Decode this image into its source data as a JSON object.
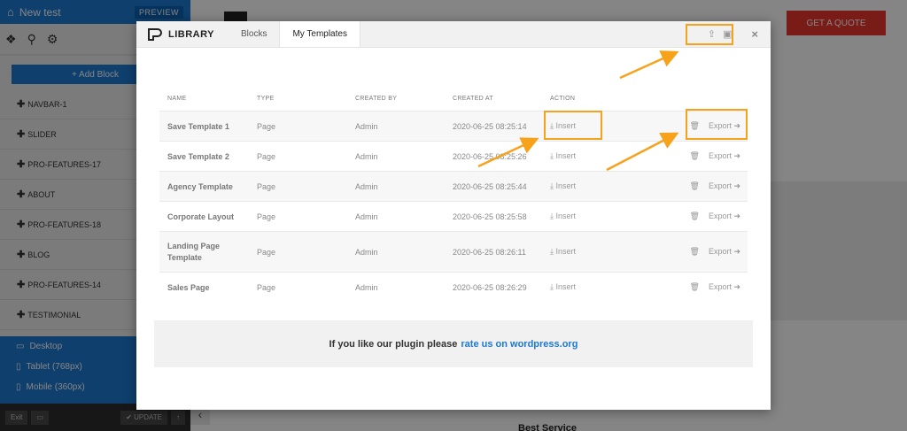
{
  "sidebar": {
    "title": "New test",
    "preview": "PREVIEW",
    "add_block": "+ Add Block",
    "items": [
      "NAVBAR-1",
      "SLIDER",
      "PRO-FEATURES-17",
      "ABOUT",
      "PRO-FEATURES-18",
      "BLOG",
      "PRO-FEATURES-14",
      "TESTIMONIAL"
    ],
    "devices": [
      "Desktop",
      "Tablet (768px)",
      "Mobile (360px)"
    ],
    "exit": "Exit",
    "update": "✔ UPDATE"
  },
  "site": {
    "quote_button": "GET A QUOTE",
    "best_service": "Best Service"
  },
  "modal": {
    "title": "LIBRARY",
    "tabs": [
      "Blocks",
      "My Templates"
    ],
    "active_tab": "My Templates",
    "close": "×",
    "columns": [
      "NAME",
      "TYPE",
      "CREATED BY",
      "CREATED AT",
      "ACTION"
    ],
    "rows": [
      {
        "name": "Save Template 1",
        "type": "Page",
        "by": "Admin",
        "at": "2020-06-25 08:25:14"
      },
      {
        "name": "Save Template 2",
        "type": "Page",
        "by": "Admin",
        "at": "2020-06-25 08:25:26"
      },
      {
        "name": "Agency Template",
        "type": "Page",
        "by": "Admin",
        "at": "2020-06-25 08:25:44"
      },
      {
        "name": "Corporate Layout",
        "type": "Page",
        "by": "Admin",
        "at": "2020-06-25 08:25:58"
      },
      {
        "name": "Landing Page Template",
        "type": "Page",
        "by": "Admin",
        "at": "2020-06-25 08:26:11"
      },
      {
        "name": "Sales Page",
        "type": "Page",
        "by": "Admin",
        "at": "2020-06-25 08:26:29"
      }
    ],
    "insert_label": "Insert",
    "export_label": "Export",
    "banner_text": "If you like our plugin please",
    "banner_link": "rate us on wordpress.org"
  },
  "colors": {
    "accent": "#1d79d2",
    "highlight": "#f7a21b",
    "quote": "#e8362f"
  }
}
